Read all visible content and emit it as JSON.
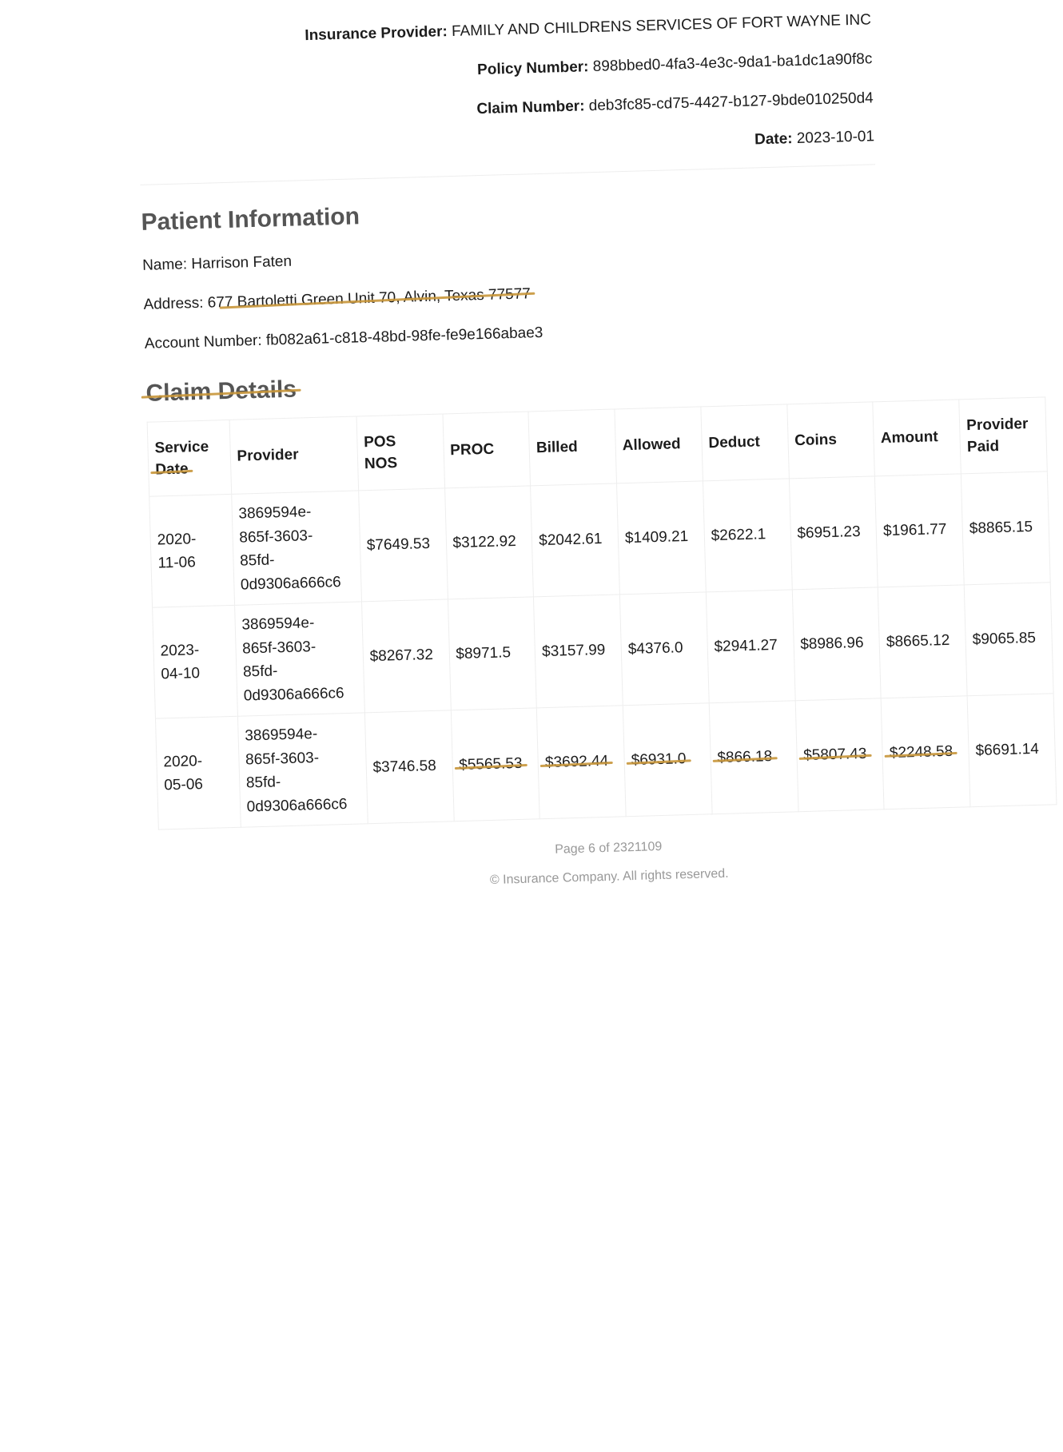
{
  "header": {
    "insurance_provider_label": "Insurance Provider:",
    "insurance_provider": "FAMILY AND CHILDRENS SERVICES OF FORT WAYNE INC",
    "policy_number_label": "Policy Number:",
    "policy_number": "898bbed0-4fa3-4e3c-9da1-ba1dc1a90f8c",
    "claim_number_label": "Claim Number:",
    "claim_number": "deb3fc85-cd75-4427-b127-9bde010250d4",
    "date_label": "Date:",
    "date": "2023-10-01"
  },
  "patient": {
    "heading": "Patient Information",
    "name_label": "Name:",
    "name": "Harrison Faten",
    "address_label": "Address:",
    "address_prefix": "67",
    "address_struck": "7 Bartoletti Green Unit 70, Alvin, Texas 77577",
    "account_label": "Account Number:",
    "account_number": "fb082a61-c818-48bd-98fe-fe9e166abae3"
  },
  "claims": {
    "heading": "Claim Details",
    "columns": {
      "service_date_1": "Service",
      "service_date_2": "Date",
      "provider": "Provider",
      "pos_1": "POS",
      "pos_2": "NOS",
      "proc": "PROC",
      "billed": "Billed",
      "allowed": "Allowed",
      "deduct": "Deduct",
      "coins": "Coins",
      "amount": "Amount",
      "provider_paid_1": "Provider",
      "provider_paid_2": "Paid"
    },
    "rows": [
      {
        "date_1": "2020-",
        "date_2": "11-06",
        "provider_1": "3869594e-",
        "provider_2": "865f-3603-",
        "provider_3": "85fd-",
        "provider_4": "0d9306a666c6",
        "pos_nos": "$7649.53",
        "proc": "$3122.92",
        "billed": "$2042.61",
        "allowed": "$1409.21",
        "deduct": "$2622.1",
        "coins": "$6951.23",
        "amount": "$1961.77",
        "provider_paid": "$8865.15"
      },
      {
        "date_1": "2023-",
        "date_2": "04-10",
        "provider_1": "3869594e-",
        "provider_2": "865f-3603-",
        "provider_3": "85fd-",
        "provider_4": "0d9306a666c6",
        "pos_nos": "$8267.32",
        "proc": "$8971.5",
        "billed": "$3157.99",
        "allowed": "$4376.0",
        "deduct": "$2941.27",
        "coins": "$8986.96",
        "amount": "$8665.12",
        "provider_paid": "$9065.85"
      },
      {
        "date_1": "2020-",
        "date_2": "05-06",
        "provider_1": "3869594e-",
        "provider_2": "865f-3603-",
        "provider_3": "85fd-",
        "provider_4": "0d9306a666c6",
        "pos_nos": "$3746.58",
        "proc": "$5565.53",
        "billed": "$3692.44",
        "allowed": "$6931.0",
        "deduct": "$866.18",
        "coins": "$5807.43",
        "amount": "$2248.58",
        "provider_paid": "$6691.14"
      }
    ]
  },
  "footer": {
    "page": "Page 6 of 2321109",
    "copyright": "© Insurance Company. All rights reserved."
  },
  "colors": {
    "strike_mark": "#c8963a",
    "heading_gray": "#555555",
    "footer_gray": "#999999"
  }
}
